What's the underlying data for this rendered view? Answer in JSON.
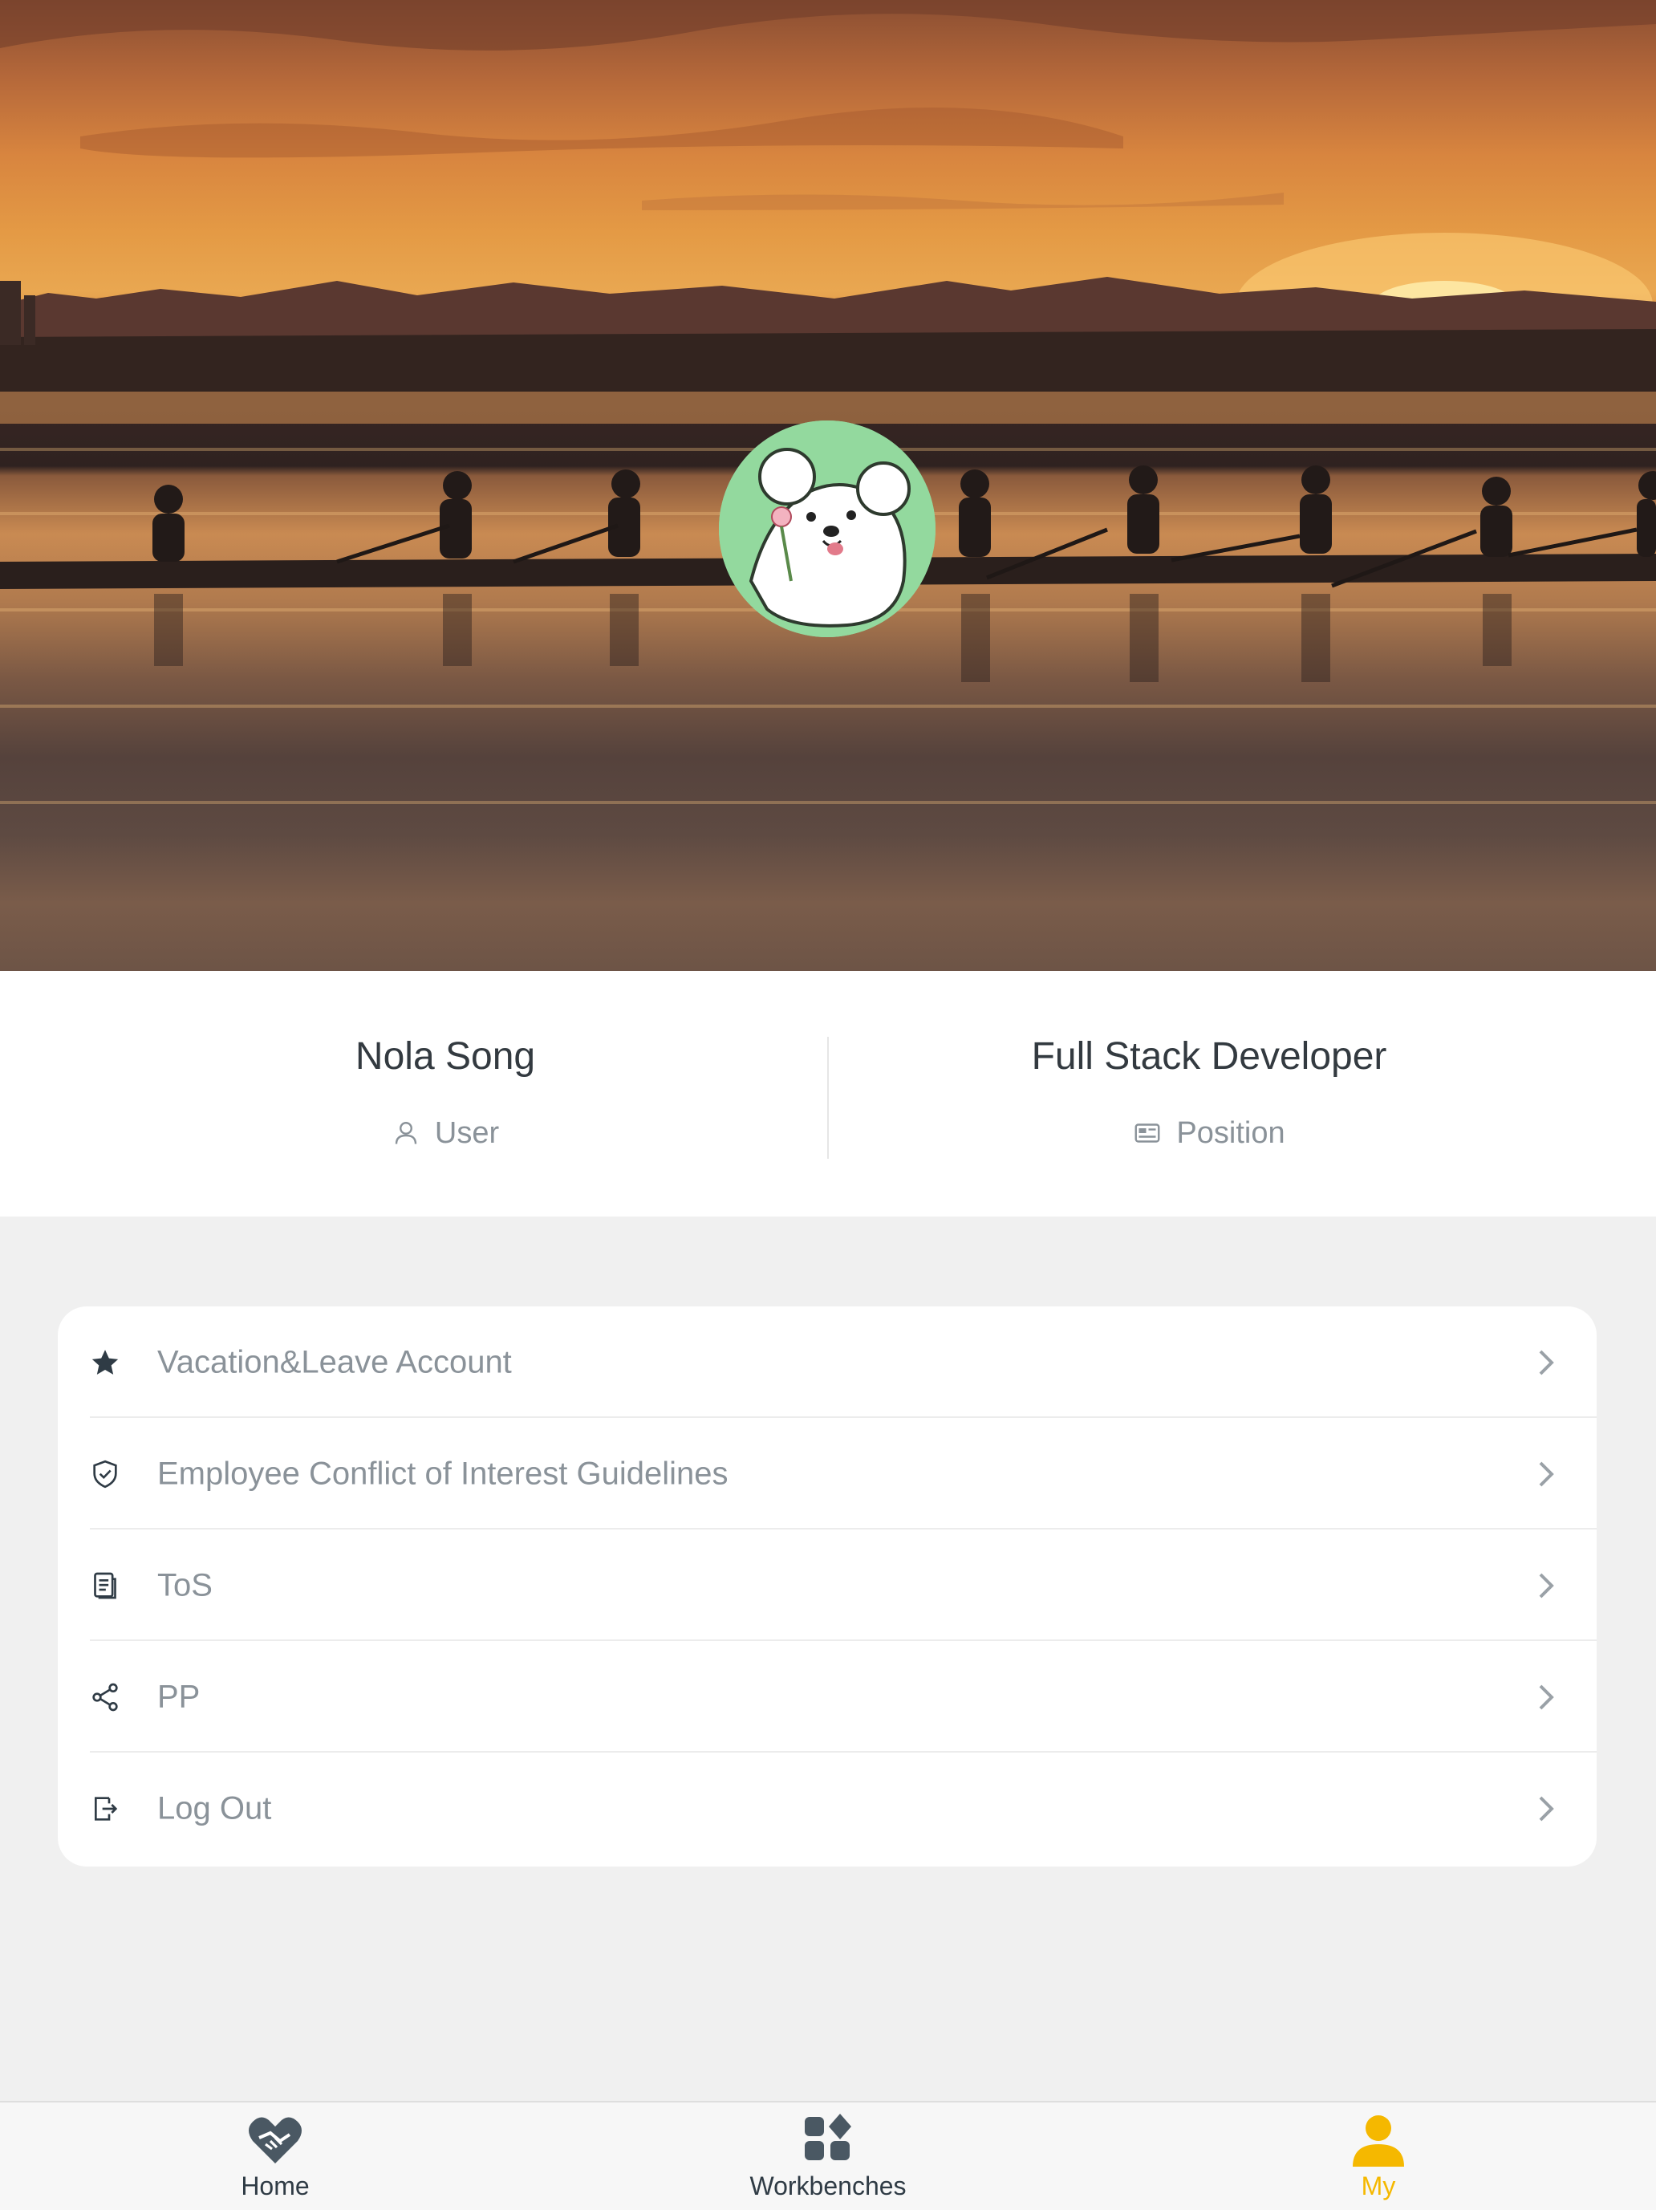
{
  "profile": {
    "name": "Nola Song",
    "role_label": "User",
    "position": "Full Stack Developer",
    "position_label": "Position"
  },
  "menu": {
    "items": [
      {
        "label": "Vacation&Leave Account",
        "icon": "star-icon"
      },
      {
        "label": "Employee Conflict of Interest Guidelines",
        "icon": "shield-check-icon"
      },
      {
        "label": "ToS",
        "icon": "document-icon"
      },
      {
        "label": "PP",
        "icon": "share-icon"
      },
      {
        "label": "Log Out",
        "icon": "logout-icon"
      }
    ]
  },
  "tabbar": {
    "tabs": [
      {
        "label": "Home",
        "icon": "heart-handshake-icon",
        "active": false
      },
      {
        "label": "Workbenches",
        "icon": "grid-apps-icon",
        "active": false
      },
      {
        "label": "My",
        "icon": "person-icon",
        "active": true
      }
    ]
  },
  "colors": {
    "accent": "#f5b800",
    "text_primary": "#333a40",
    "text_secondary": "#8a9299",
    "icon_dark": "#2f3b45",
    "page_bg": "#f0f0f0",
    "avatar_bg": "#93d99e"
  }
}
